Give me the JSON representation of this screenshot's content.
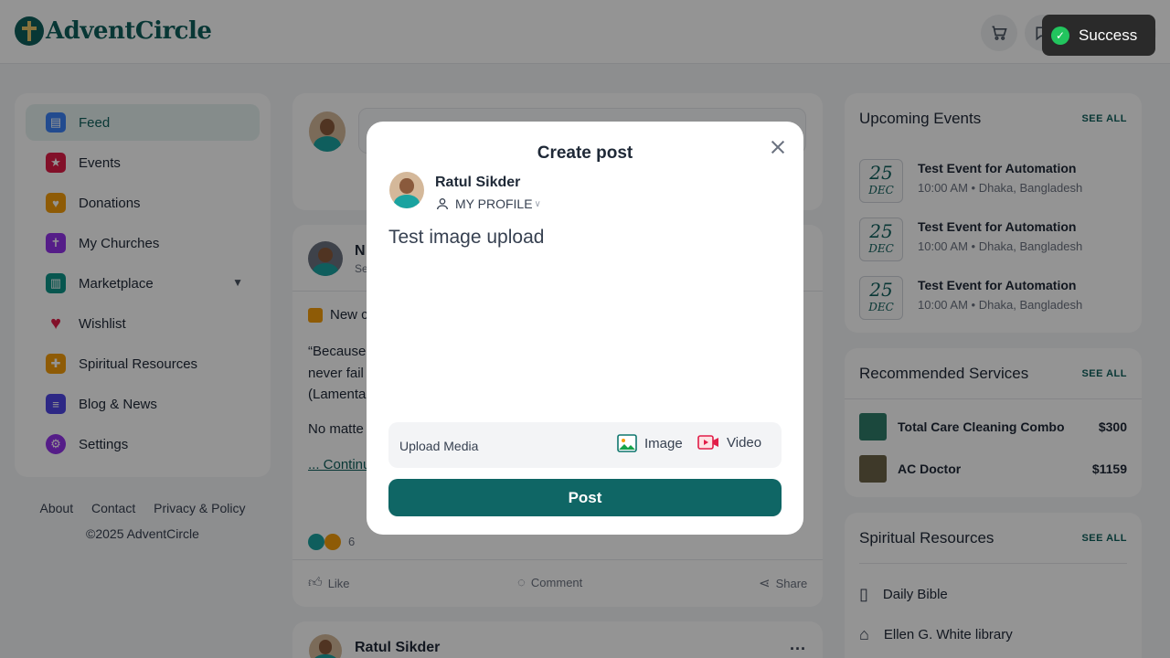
{
  "app": {
    "name": "AdventCircle"
  },
  "toast": {
    "message": "Success"
  },
  "sidebar": {
    "items": [
      {
        "label": "Feed",
        "icon": "feed-icon",
        "active": true
      },
      {
        "label": "Events",
        "icon": "calendar-icon"
      },
      {
        "label": "Donations",
        "icon": "donation-box-icon"
      },
      {
        "label": "My Churches",
        "icon": "church-icon"
      },
      {
        "label": "Marketplace",
        "icon": "store-icon",
        "has_submenu": true
      },
      {
        "label": "Wishlist",
        "icon": "heart-icon"
      },
      {
        "label": "Spiritual Resources",
        "icon": "bible-icon"
      },
      {
        "label": "Blog & News",
        "icon": "news-icon"
      },
      {
        "label": "Settings",
        "icon": "gear-icon"
      }
    ]
  },
  "footer": {
    "links": [
      "About",
      "Contact",
      "Privacy & Policy"
    ],
    "copyright": "©2025 AdventCircle"
  },
  "feed": {
    "post1": {
      "author_initial": "N",
      "subtitle_fragment": "Se",
      "line1": "New c",
      "quote_lines": [
        "“Because",
        "never fail",
        "(Lamenta"
      ],
      "line_no_matter": "No matte",
      "continue_link": "... Continu",
      "reaction_count": "6",
      "actions": {
        "like": "Like",
        "comment": "Comment",
        "share": "Share"
      }
    },
    "post2": {
      "author": "Ratul Sikder"
    }
  },
  "right": {
    "events": {
      "title": "Upcoming Events",
      "see_all": "SEE ALL",
      "items": [
        {
          "day": "25",
          "month": "DEC",
          "title": "Test Event for Automation",
          "meta": "10:00 AM • Dhaka, Bangladesh"
        },
        {
          "day": "25",
          "month": "DEC",
          "title": "Test Event for Automation",
          "meta": "10:00 AM • Dhaka, Bangladesh"
        },
        {
          "day": "25",
          "month": "DEC",
          "title": "Test Event for Automation",
          "meta": "10:00 AM • Dhaka, Bangladesh"
        }
      ]
    },
    "services": {
      "title": "Recommended Services",
      "see_all": "SEE ALL",
      "items": [
        {
          "name": "Total Care Cleaning Combo",
          "price": "$300"
        },
        {
          "name": "AC Doctor",
          "price": "$1159"
        }
      ]
    },
    "resources": {
      "title": "Spiritual Resources",
      "see_all": "SEE ALL",
      "items": [
        {
          "label": "Daily Bible",
          "icon": "book-icon"
        },
        {
          "label": "Ellen G. White library",
          "icon": "library-icon"
        }
      ]
    }
  },
  "modal": {
    "title": "Create post",
    "user_name": "Ratul Sikder",
    "audience": "MY PROFILE",
    "post_text": "Test image upload",
    "upload_label": "Upload Media",
    "image_label": "Image",
    "video_label": "Video",
    "post_button": "Post"
  }
}
